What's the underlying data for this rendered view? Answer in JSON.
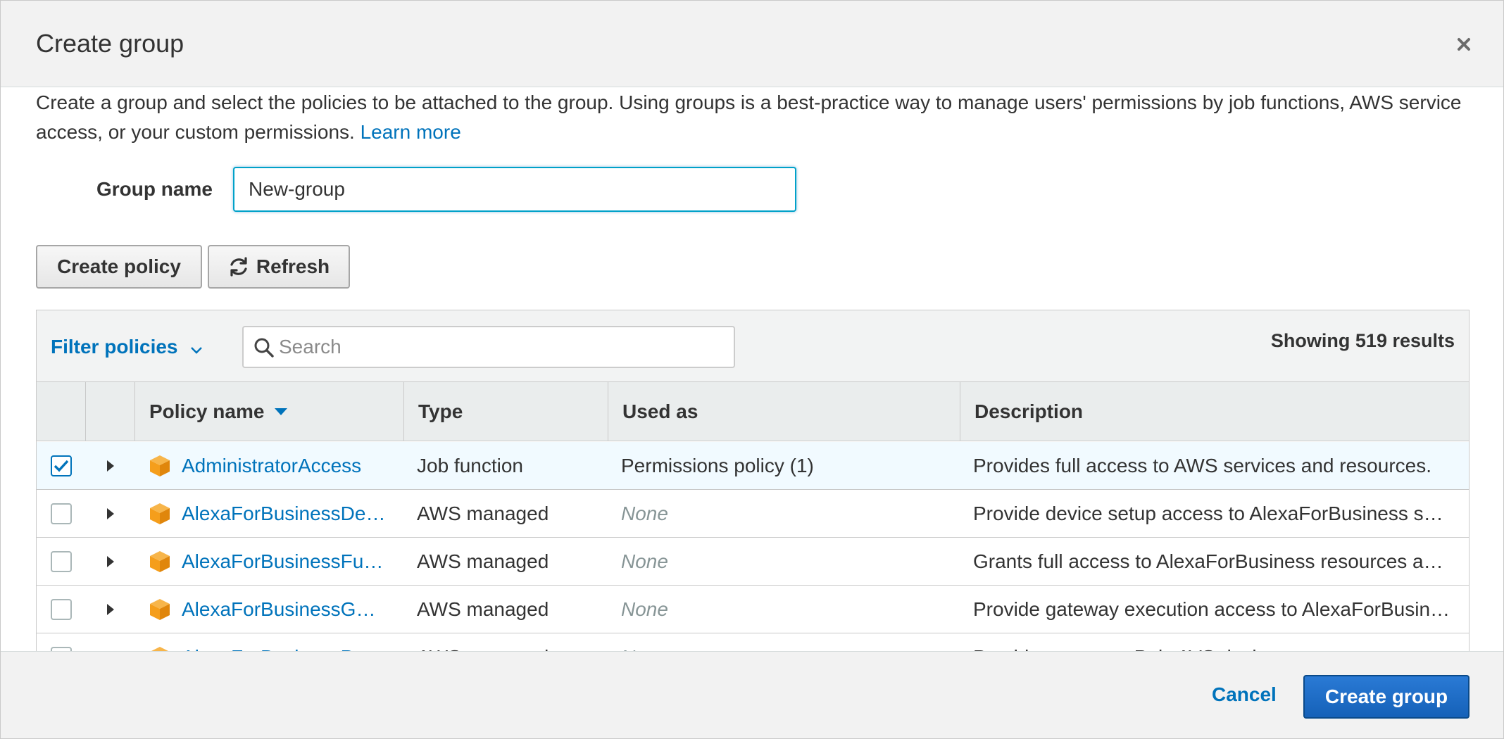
{
  "dialog": {
    "title": "Create group",
    "intro_text": "Create a group and select the policies to be attached to the group. Using groups is a best-practice way to manage users' permissions by job functions, AWS service access, or your custom permissions. ",
    "learn_more": "Learn more"
  },
  "form": {
    "group_name_label": "Group name",
    "group_name_value": "New-group"
  },
  "toolbar": {
    "create_policy_label": "Create policy",
    "refresh_label": "Refresh"
  },
  "filter": {
    "filter_label": "Filter policies",
    "search_placeholder": "Search",
    "results_text": "Showing 519 results"
  },
  "table": {
    "headers": {
      "policy_name": "Policy name",
      "type": "Type",
      "used_as": "Used as",
      "description": "Description"
    },
    "rows": [
      {
        "name": "AdministratorAccess",
        "type": "Job function",
        "used_as": "Permissions policy (1)",
        "description": "Provides full access to AWS services and resources.",
        "checked": true
      },
      {
        "name": "AlexaForBusinessDe…",
        "type": "AWS managed",
        "used_as": "None",
        "description": "Provide device setup access to AlexaForBusiness s…",
        "checked": false
      },
      {
        "name": "AlexaForBusinessFul…",
        "type": "AWS managed",
        "used_as": "None",
        "description": "Grants full access to AlexaForBusiness resources a…",
        "checked": false
      },
      {
        "name": "AlexaForBusinessGa…",
        "type": "AWS managed",
        "used_as": "None",
        "description": "Provide gateway execution access to AlexaForBusin…",
        "checked": false
      },
      {
        "name": "AlexaForBusinessPo…",
        "type": "AWS managed",
        "used_as": "None",
        "description": "Provide access to Poly AVS devices",
        "checked": false
      }
    ]
  },
  "footer": {
    "cancel_label": "Cancel",
    "create_group_label": "Create group"
  },
  "colors": {
    "link": "#0073bb",
    "primary": "#1b6ac9",
    "policy_icon": "#f59e1b",
    "selected_row": "#f1faff"
  }
}
